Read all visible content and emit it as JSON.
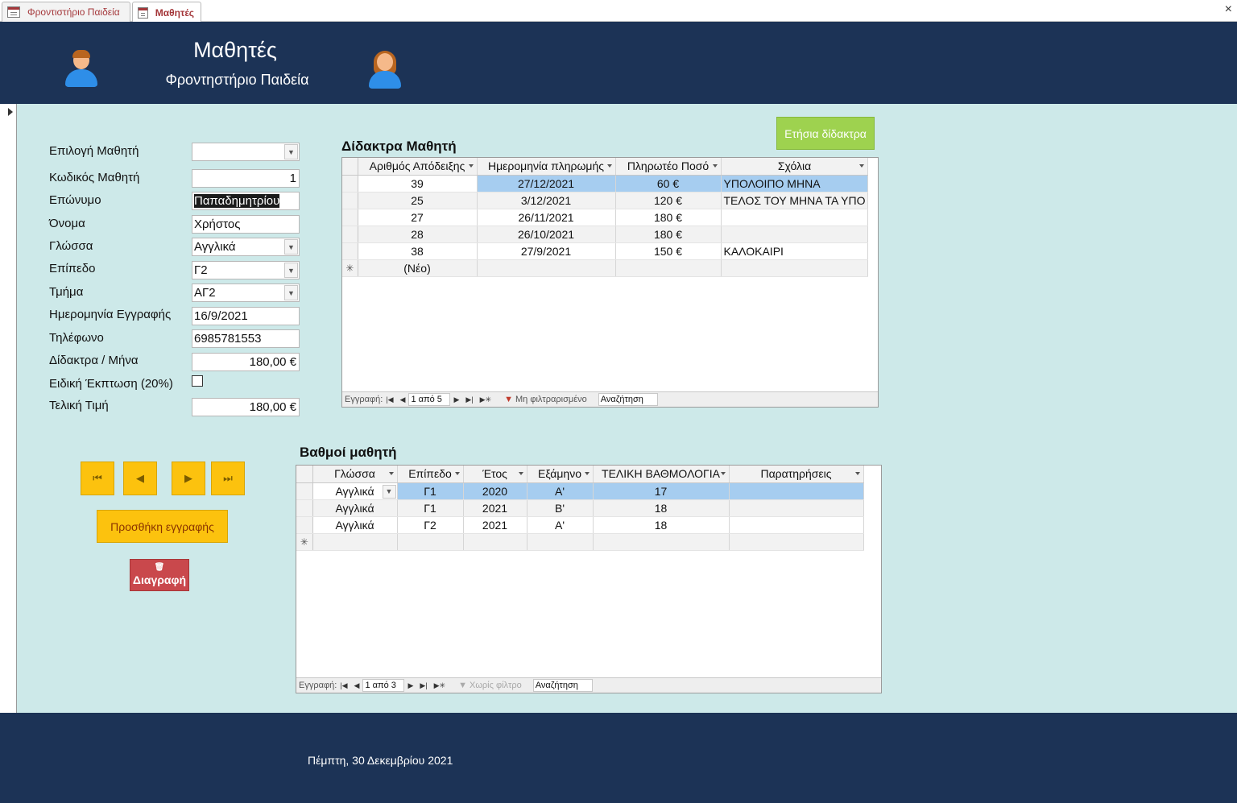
{
  "tabs": [
    {
      "label": "Φροντιστήριο Παιδεία"
    },
    {
      "label": "Μαθητές"
    }
  ],
  "close_symbol": "×",
  "header": {
    "title": "Μαθητές",
    "subtitle": "Φροντηστήριο Παιδεία",
    "icons": [
      "male-student-icon",
      "female-student-icon"
    ]
  },
  "form": {
    "fields": {
      "select_student": {
        "label": "Επιλογή Μαθητή",
        "value": ""
      },
      "student_code": {
        "label": "Κωδικός Μαθητή",
        "value": "1"
      },
      "surname": {
        "label": "Επώνυμο",
        "value": "Παπαδημητρίου"
      },
      "name": {
        "label": "Όνομα",
        "value": "Χρήστος"
      },
      "language": {
        "label": "Γλώσσα",
        "value": "Αγγλικά"
      },
      "level": {
        "label": "Επίπεδο",
        "value": "Γ2"
      },
      "class": {
        "label": "Τμήμα",
        "value": "ΑΓ2"
      },
      "registration_date": {
        "label": "Ημερομηνία Εγγραφής",
        "value": "16/9/2021"
      },
      "phone": {
        "label": "Τηλέφωνο",
        "value": "6985781553"
      },
      "monthly_fee": {
        "label": "Δίδακτρα / Μήνα",
        "value": "180,00 €"
      },
      "special_discount": {
        "label": "Ειδική Έκπτωση (20%)",
        "checked": false
      },
      "final_price": {
        "label": "Τελική Τιμή",
        "value": "180,00 €"
      }
    }
  },
  "buttons": {
    "first": "⏮",
    "prev": "◀",
    "next": "▶",
    "last": "⏭",
    "add_record": "Προσθήκη εγγραφής",
    "delete_icon": "🗑",
    "delete": "Διαγραφή",
    "annual_fees": "Ετήσια δίδακτρα"
  },
  "fees": {
    "title": "Δίδακτρα Μαθητή",
    "columns": [
      "Αριθμός Απόδειξης",
      "Ημερομηνία πληρωμής",
      "Πληρωτέο Ποσό",
      "Σχόλια"
    ],
    "rows": [
      [
        "39",
        "27/12/2021",
        "60 €",
        "ΥΠΟΛΟΙΠΟ ΜΗΝΑ"
      ],
      [
        "25",
        "3/12/2021",
        "120 €",
        "ΤΕΛΟΣ ΤΟΥ ΜΗΝΑ ΤΑ ΥΠΟ"
      ],
      [
        "27",
        "26/11/2021",
        "180 €",
        ""
      ],
      [
        "28",
        "26/10/2021",
        "180 €",
        ""
      ],
      [
        "38",
        "27/9/2021",
        "150 €",
        "ΚΑΛΟΚΑΙΡΙ"
      ]
    ],
    "new_row": "(Νέο)",
    "new_row_marker": "✳",
    "nav": {
      "record_label": "Εγγραφή:",
      "position": "1 από 5",
      "filter": "Μη φιλτραρισμένο",
      "search": "Αναζήτηση"
    }
  },
  "grades": {
    "title": "Βαθμοί μαθητή",
    "columns": [
      "Γλώσσα",
      "Επίπεδο",
      "Έτος",
      "Εξάμηνο",
      "ΤΕΛΙΚΗ ΒΑΘΜΟΛΟΓΙΑ",
      "Παρατηρήσεις"
    ],
    "rows": [
      [
        "Αγγλικά",
        "Γ1",
        "2020",
        "Α'",
        "17",
        ""
      ],
      [
        "Αγγλικά",
        "Γ1",
        "2021",
        "Β'",
        "18",
        ""
      ],
      [
        "Αγγλικά",
        "Γ2",
        "2021",
        "Α'",
        "18",
        ""
      ]
    ],
    "new_row_marker": "✳",
    "nav": {
      "record_label": "Εγγραφή:",
      "position": "1 από 3",
      "filter": "Χωρίς φίλτρο",
      "search": "Αναζήτηση"
    }
  },
  "footer": {
    "date": "Πέμπτη, 30 Δεκεμβρίου 2021"
  },
  "colors": {
    "header_bg": "#1c3356",
    "detail_bg": "#cde9e9",
    "nav_button": "#fcc20e",
    "delete_button": "#c9484c",
    "annual_button": "#9ed24f",
    "selected_row": "#a6cdf0"
  }
}
